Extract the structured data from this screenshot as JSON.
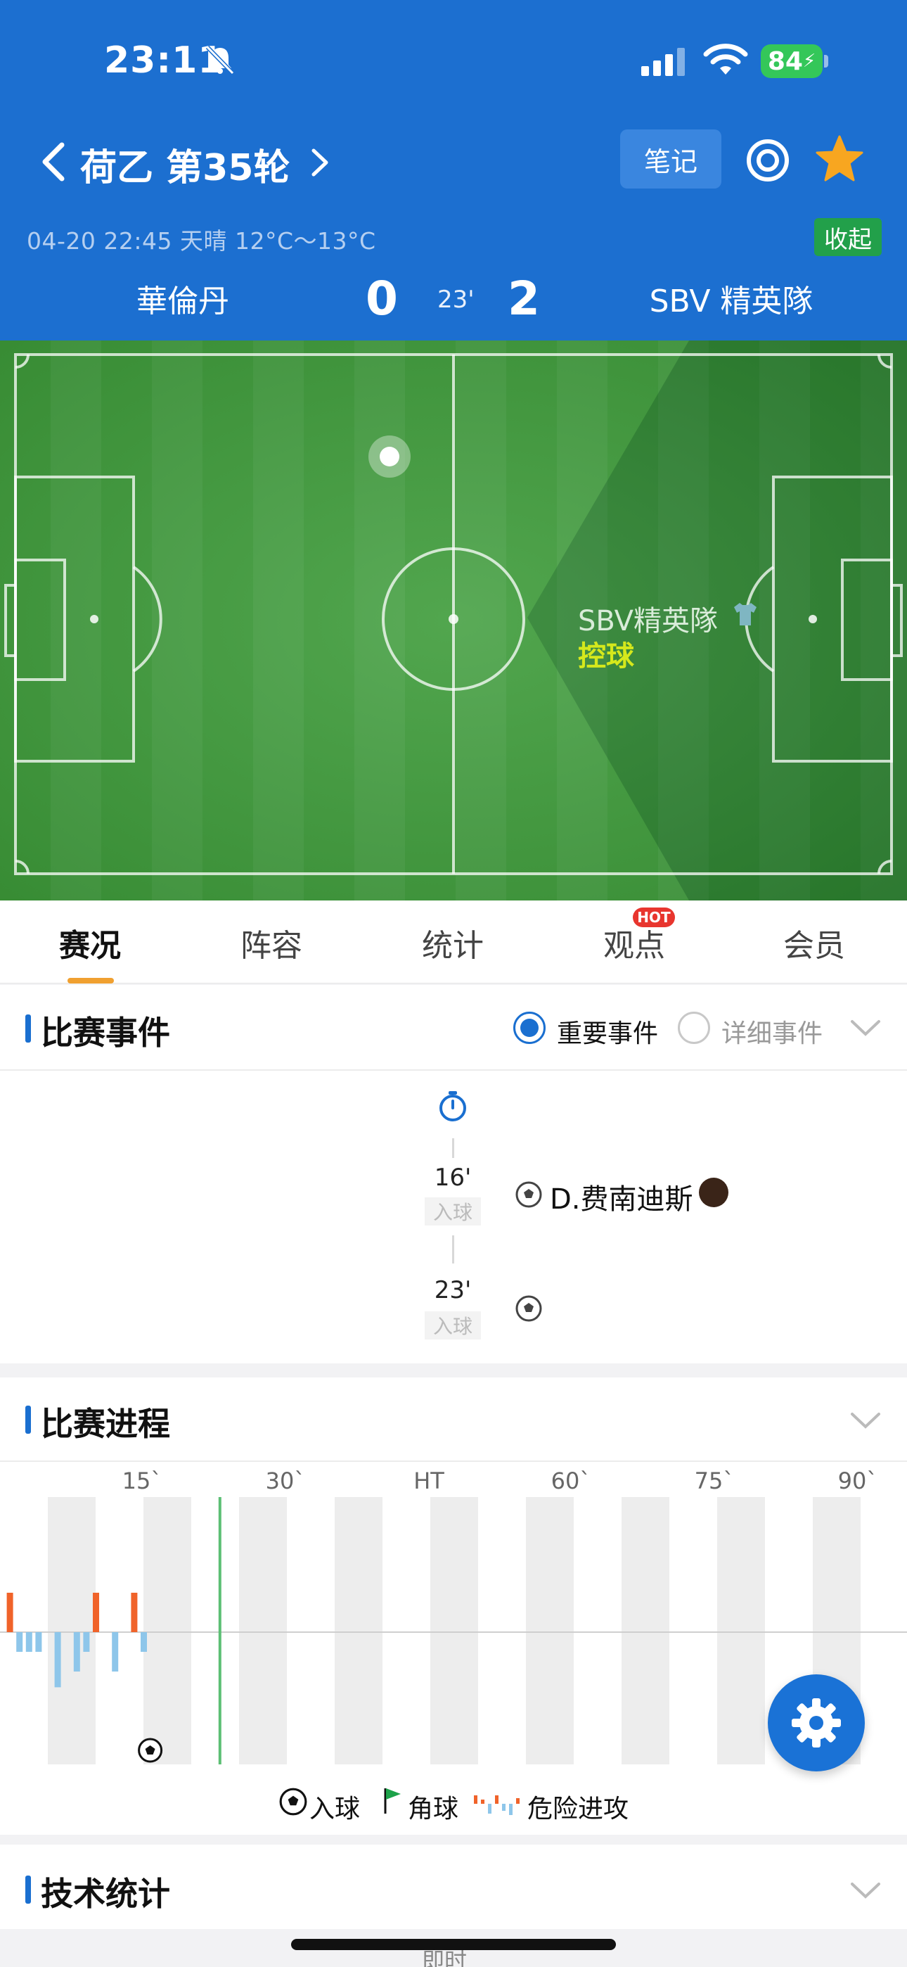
{
  "status_bar": {
    "time": "23:11",
    "battery": "84"
  },
  "nav": {
    "title": "荷乙 第35轮",
    "notes_label": "笔记"
  },
  "match": {
    "info": "04-20 22:45   天晴 12°C～13°C",
    "collapse_label": "收起",
    "home_team": "華倫丹",
    "away_team": "SBV 精英隊",
    "home_score": "0",
    "away_score": "2",
    "minute": "23'"
  },
  "pitch": {
    "possession_team": "SBV精英隊",
    "possession_label": "控球"
  },
  "tabs": [
    {
      "label": "赛况",
      "active": true
    },
    {
      "label": "阵容"
    },
    {
      "label": "统计"
    },
    {
      "label": "观点",
      "badge": "HOT"
    },
    {
      "label": "会员"
    }
  ],
  "events": {
    "title": "比赛事件",
    "filter_important": "重要事件",
    "filter_detail": "详细事件",
    "items": [
      {
        "minute": "16'",
        "tag": "入球",
        "player": "D.费南迪斯",
        "icon": "ball-icon"
      },
      {
        "minute": "23'",
        "tag": "入球",
        "player": "",
        "icon": "ball-icon"
      }
    ]
  },
  "progress": {
    "title": "比赛进程",
    "axis_ticks": [
      "15`",
      "30`",
      "HT",
      "60`",
      "75`",
      "90`"
    ],
    "legend": {
      "goal": "入球",
      "corner": "角球",
      "danger": "危险进攻"
    },
    "chart_data": {
      "type": "bar",
      "current_minute": 23,
      "x_range": [
        0,
        95
      ],
      "series": [
        {
          "name": "home",
          "color": "#f0632a",
          "minutes": [
            1,
            10,
            14
          ],
          "values": [
            1,
            1,
            1
          ]
        },
        {
          "name": "away",
          "color": "#8ec6ea",
          "minutes": [
            2,
            3,
            4,
            6,
            8,
            9,
            12,
            15
          ],
          "values": [
            0.5,
            0.5,
            0.5,
            1.4,
            1.0,
            0.5,
            1.0,
            0.5
          ]
        }
      ],
      "goal_minutes": [
        16
      ]
    }
  },
  "tech": {
    "title": "技术统计"
  },
  "bottom_peek": "即时"
}
